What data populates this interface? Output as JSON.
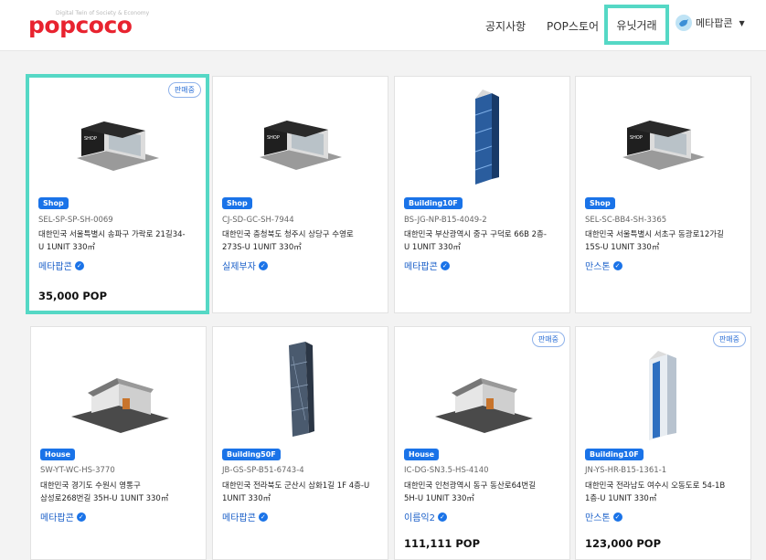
{
  "header": {
    "logo_tagline": "Digital Twin of Society & Economy",
    "logo_text": "popcoco",
    "nav": [
      "공지사항",
      "POP스토어",
      "유닛거래"
    ],
    "user_name": "메타팝콘"
  },
  "cards": [
    {
      "sale": "판매중",
      "type": "Shop",
      "code": "SEL-SP-SP-SH-0069",
      "addr1": "대한민국 서울특별시 송파구 가락로 21길34-",
      "addr2": "U 1UNIT 330㎡",
      "owner": "메타팝콘",
      "price": "35,000 POP"
    },
    {
      "sale": "",
      "type": "Shop",
      "code": "CJ-SD-GC-SH-7944",
      "addr1": "대한민국 충청북도 청주시 상당구 수영로",
      "addr2": "273S-U 1UNIT 330㎡",
      "owner": "실제부자",
      "price": ""
    },
    {
      "sale": "",
      "type": "Building10F",
      "code": "BS-JG-NP-B15-4049-2",
      "addr1": "대한민국 부산광역시 중구 구덕로 66B 2층-",
      "addr2": "U 1UNIT 330㎡",
      "owner": "메타팝콘",
      "price": ""
    },
    {
      "sale": "",
      "type": "Shop",
      "code": "SEL-SC-BB4-SH-3365",
      "addr1": "대한민국 서울특별시 서초구 동광로12가길",
      "addr2": "15S-U 1UNIT 330㎡",
      "owner": "만스톤",
      "price": ""
    },
    {
      "sale": "",
      "type": "House",
      "code": "SW-YT-WC-HS-3770",
      "addr1": "대한민국 경기도 수원시 영통구",
      "addr2": "삼성로268번길 35H-U 1UNIT 330㎡",
      "owner": "메타팝콘",
      "price": ""
    },
    {
      "sale": "",
      "type": "Building50F",
      "code": "JB-GS-SP-B51-6743-4",
      "addr1": "대한민국 전라북도 군산시 삼화1길 1F 4층-U",
      "addr2": "1UNIT 330㎡",
      "owner": "메타팝콘",
      "price": ""
    },
    {
      "sale": "판매중",
      "type": "House",
      "code": "IC-DG-SN3.5-HS-4140",
      "addr1": "대한민국 인천광역시 동구 동산로64번길",
      "addr2": "5H-U 1UNIT 330㎡",
      "owner": "이름익2",
      "price": "111,111 POP"
    },
    {
      "sale": "판매중",
      "type": "Building10F",
      "code": "JN-YS-HR-B15-1361-1",
      "addr1": "대한민국 전라남도 여수시 오동도로 54-1B",
      "addr2": "1층-U 1UNIT 330㎡",
      "owner": "만스톤",
      "price": "123,000 POP"
    }
  ],
  "colors": {
    "brand": "#e8232f",
    "accent": "#55d8c5",
    "tag": "#1a73e8"
  }
}
